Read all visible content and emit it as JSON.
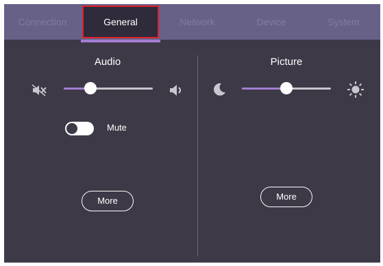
{
  "tabs": [
    {
      "label": "Connection",
      "active": false
    },
    {
      "label": "General",
      "active": true
    },
    {
      "label": "Network",
      "active": false
    },
    {
      "label": "Device",
      "active": false
    },
    {
      "label": "System",
      "active": false
    }
  ],
  "audio": {
    "title": "Audio",
    "volume_level": 0.3,
    "mute_label": "Mute",
    "mute_on": false,
    "more_label": "More",
    "left_icon": "mute-speaker-icon",
    "right_icon": "speaker-icon"
  },
  "picture": {
    "title": "Picture",
    "brightness_level": 0.5,
    "more_label": "More",
    "left_icon": "moon-icon",
    "right_icon": "sun-icon"
  },
  "colors": {
    "accent": "#a47ed2",
    "active_tab_border": "#e3212b",
    "panel_bg": "#3d3947",
    "tabbar_bg": "#676087"
  }
}
